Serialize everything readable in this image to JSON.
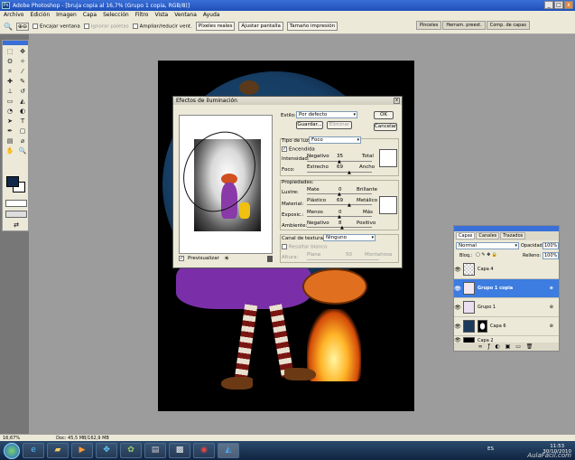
{
  "window": {
    "title": "Adobe Photoshop - [bruja copia al 16,7% (Grupo 1 copia, RGB/8)]",
    "controls": [
      "_",
      "□",
      "x"
    ]
  },
  "menu": [
    "Archivo",
    "Edición",
    "Imagen",
    "Capa",
    "Selección",
    "Filtro",
    "Vista",
    "Ventana",
    "Ayuda"
  ],
  "options": {
    "fit_window": "Encajar ventana",
    "ignore_palettes": "Ignorar paletas",
    "zoom_resize": "Ampliar/reducir vent.",
    "actual_pixels": "Píxeles reales",
    "fit_screen": "Ajustar pantalla",
    "print_size": "Tamaño impresión",
    "palette_tabs": [
      "Pinceles",
      "Herram. preest.",
      "Comp. de capas"
    ]
  },
  "dialog": {
    "title": "Efectos de iluminación",
    "style_label": "Estilo:",
    "style_value": "Por defecto",
    "save_btn": "Guardar...",
    "delete_btn": "Eliminar",
    "ok_btn": "OK",
    "cancel_btn": "Cancelar",
    "light_type_label": "Tipo de luz:",
    "light_type_value": "Foco",
    "on_label": "Encendida",
    "intensity_label": "Intensidad:",
    "intensity_min": "Negativo",
    "intensity_value": "35",
    "intensity_max": "Total",
    "focus_label": "Foco:",
    "focus_min": "Estrecho",
    "focus_value": "69",
    "focus_max": "Ancho",
    "properties_label": "Propiedades:",
    "gloss_label": "Lustre:",
    "gloss_min": "Mate",
    "gloss_value": "0",
    "gloss_max": "Brillante",
    "material_label": "Material:",
    "material_min": "Plástico",
    "material_value": "69",
    "material_max": "Metálico",
    "exposure_label": "Exposic.:",
    "exposure_min": "Menos",
    "exposure_value": "0",
    "exposure_max": "Más",
    "ambience_label": "Ambiente:",
    "ambience_min": "Negativo",
    "ambience_value": "8",
    "ambience_max": "Positivo",
    "texture_label": "Canal de textura:",
    "texture_value": "Ninguno",
    "white_high_label": "Resaltar blanco",
    "height_label": "Altura:",
    "height_min": "Plana",
    "height_value": "50",
    "height_max": "Montañosa",
    "preview_label": "Previsualizar"
  },
  "layers": {
    "tabs": [
      "Capas",
      "Canales",
      "Trazados"
    ],
    "blend_mode": "Normal",
    "opacity_label": "Opacidad:",
    "opacity_value": "100%",
    "lock_label": "Bloq.:",
    "fill_label": "Relleno:",
    "fill_value": "100%",
    "items": [
      {
        "name": "Capa 4",
        "selected": false
      },
      {
        "name": "Grupo 1 copia",
        "selected": true
      },
      {
        "name": "Grupo 1",
        "selected": false
      },
      {
        "name": "Capa 6",
        "selected": false
      },
      {
        "name": "Capa 2",
        "selected": false
      }
    ]
  },
  "status": {
    "zoom": "16,67%",
    "doc": "Doc: 45,5 MB/162,9 MB"
  },
  "taskbar": {
    "lang": "ES",
    "time": "11:53",
    "date": "30/10/2010",
    "watermark": "AulaFácil.com"
  }
}
